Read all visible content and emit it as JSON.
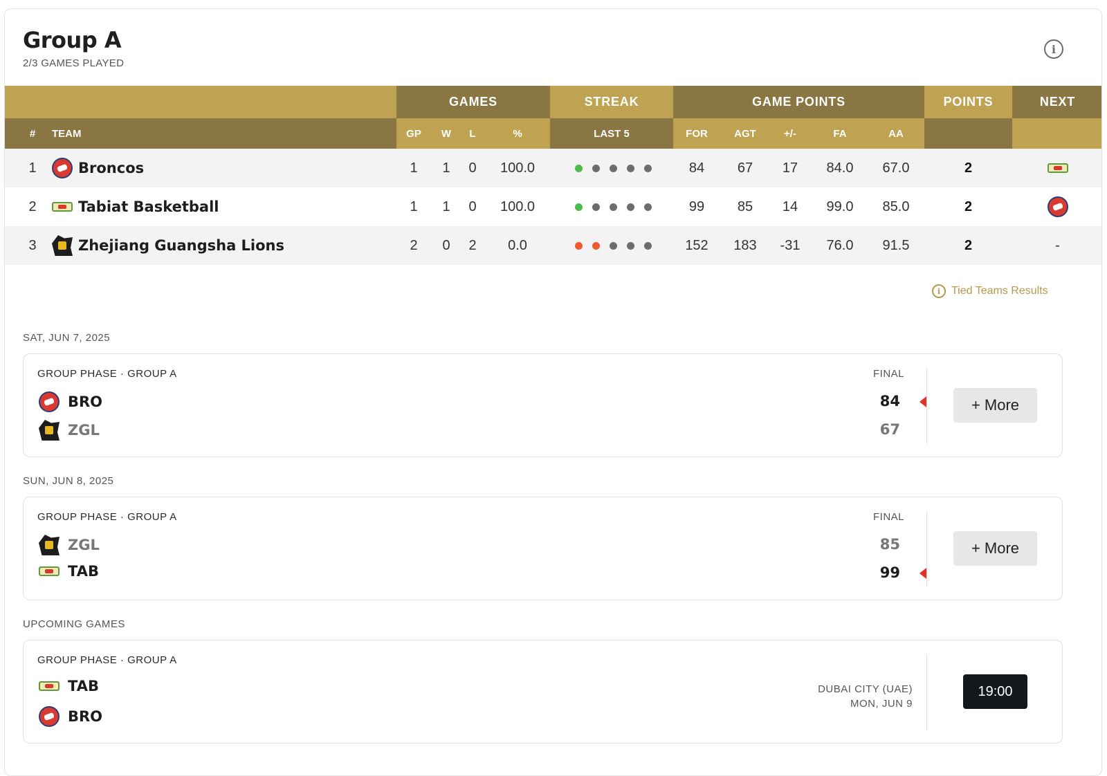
{
  "header": {
    "title": "Group A",
    "subtitle": "2/3 GAMES PLAYED",
    "info_icon": "info-icon"
  },
  "table": {
    "group_headers": {
      "games": "GAMES",
      "streak": "STREAK",
      "game_points": "GAME POINTS",
      "points": "POINTS",
      "next": "NEXT"
    },
    "columns": {
      "rank": "#",
      "team": "TEAM",
      "gp": "GP",
      "w": "W",
      "l": "L",
      "pct": "%",
      "last5": "LAST 5",
      "for": "FOR",
      "agt": "AGT",
      "diff": "+/-",
      "fa": "FA",
      "aa": "AA"
    },
    "rows": [
      {
        "rank": "1",
        "team": "Broncos",
        "logo": "broncos-logo",
        "gp": "1",
        "w": "1",
        "l": "0",
        "pct": "100.0",
        "streak": [
          "win",
          "none",
          "none",
          "none",
          "none"
        ],
        "for": "84",
        "agt": "67",
        "diff": "17",
        "fa": "84.0",
        "aa": "67.0",
        "points": "2",
        "next": "tabiat-logo"
      },
      {
        "rank": "2",
        "team": "Tabiat Basketball",
        "logo": "tabiat-logo",
        "gp": "1",
        "w": "1",
        "l": "0",
        "pct": "100.0",
        "streak": [
          "win",
          "none",
          "none",
          "none",
          "none"
        ],
        "for": "99",
        "agt": "85",
        "diff": "14",
        "fa": "99.0",
        "aa": "85.0",
        "points": "2",
        "next": "broncos-logo"
      },
      {
        "rank": "3",
        "team": "Zhejiang Guangsha Lions",
        "logo": "zhejiang-logo",
        "gp": "2",
        "w": "0",
        "l": "2",
        "pct": "0.0",
        "streak": [
          "loss",
          "loss",
          "none",
          "none",
          "none"
        ],
        "for": "152",
        "agt": "183",
        "diff": "-31",
        "fa": "76.0",
        "aa": "91.5",
        "points": "2",
        "next": "-"
      }
    ]
  },
  "tied_link": "Tied Teams Results",
  "games": [
    {
      "date": "SAT, JUN 7, 2025",
      "phase": "GROUP PHASE · GROUP A",
      "status": "FINAL",
      "team1": {
        "abbr": "BRO",
        "score": "84",
        "winner": true
      },
      "team2": {
        "abbr": "ZGL",
        "score": "67",
        "winner": false
      },
      "action": "+ More"
    },
    {
      "date": "SUN, JUN 8, 2025",
      "phase": "GROUP PHASE · GROUP A",
      "status": "FINAL",
      "team1": {
        "abbr": "ZGL",
        "score": "85",
        "winner": false
      },
      "team2": {
        "abbr": "TAB",
        "score": "99",
        "winner": true
      },
      "action": "+ More"
    }
  ],
  "upcoming": {
    "label": "UPCOMING GAMES",
    "phase": "GROUP PHASE · GROUP A",
    "team1": "TAB",
    "team2": "BRO",
    "venue": "DUBAI CITY (UAE)",
    "date": "MON, JUN 9",
    "time": "19:00"
  },
  "colors": {
    "gold_light": "#bfa352",
    "gold_dark": "#8a7643",
    "win": "#4cbb4c",
    "loss": "#f15a2c",
    "neutral": "#6d6d6d"
  }
}
